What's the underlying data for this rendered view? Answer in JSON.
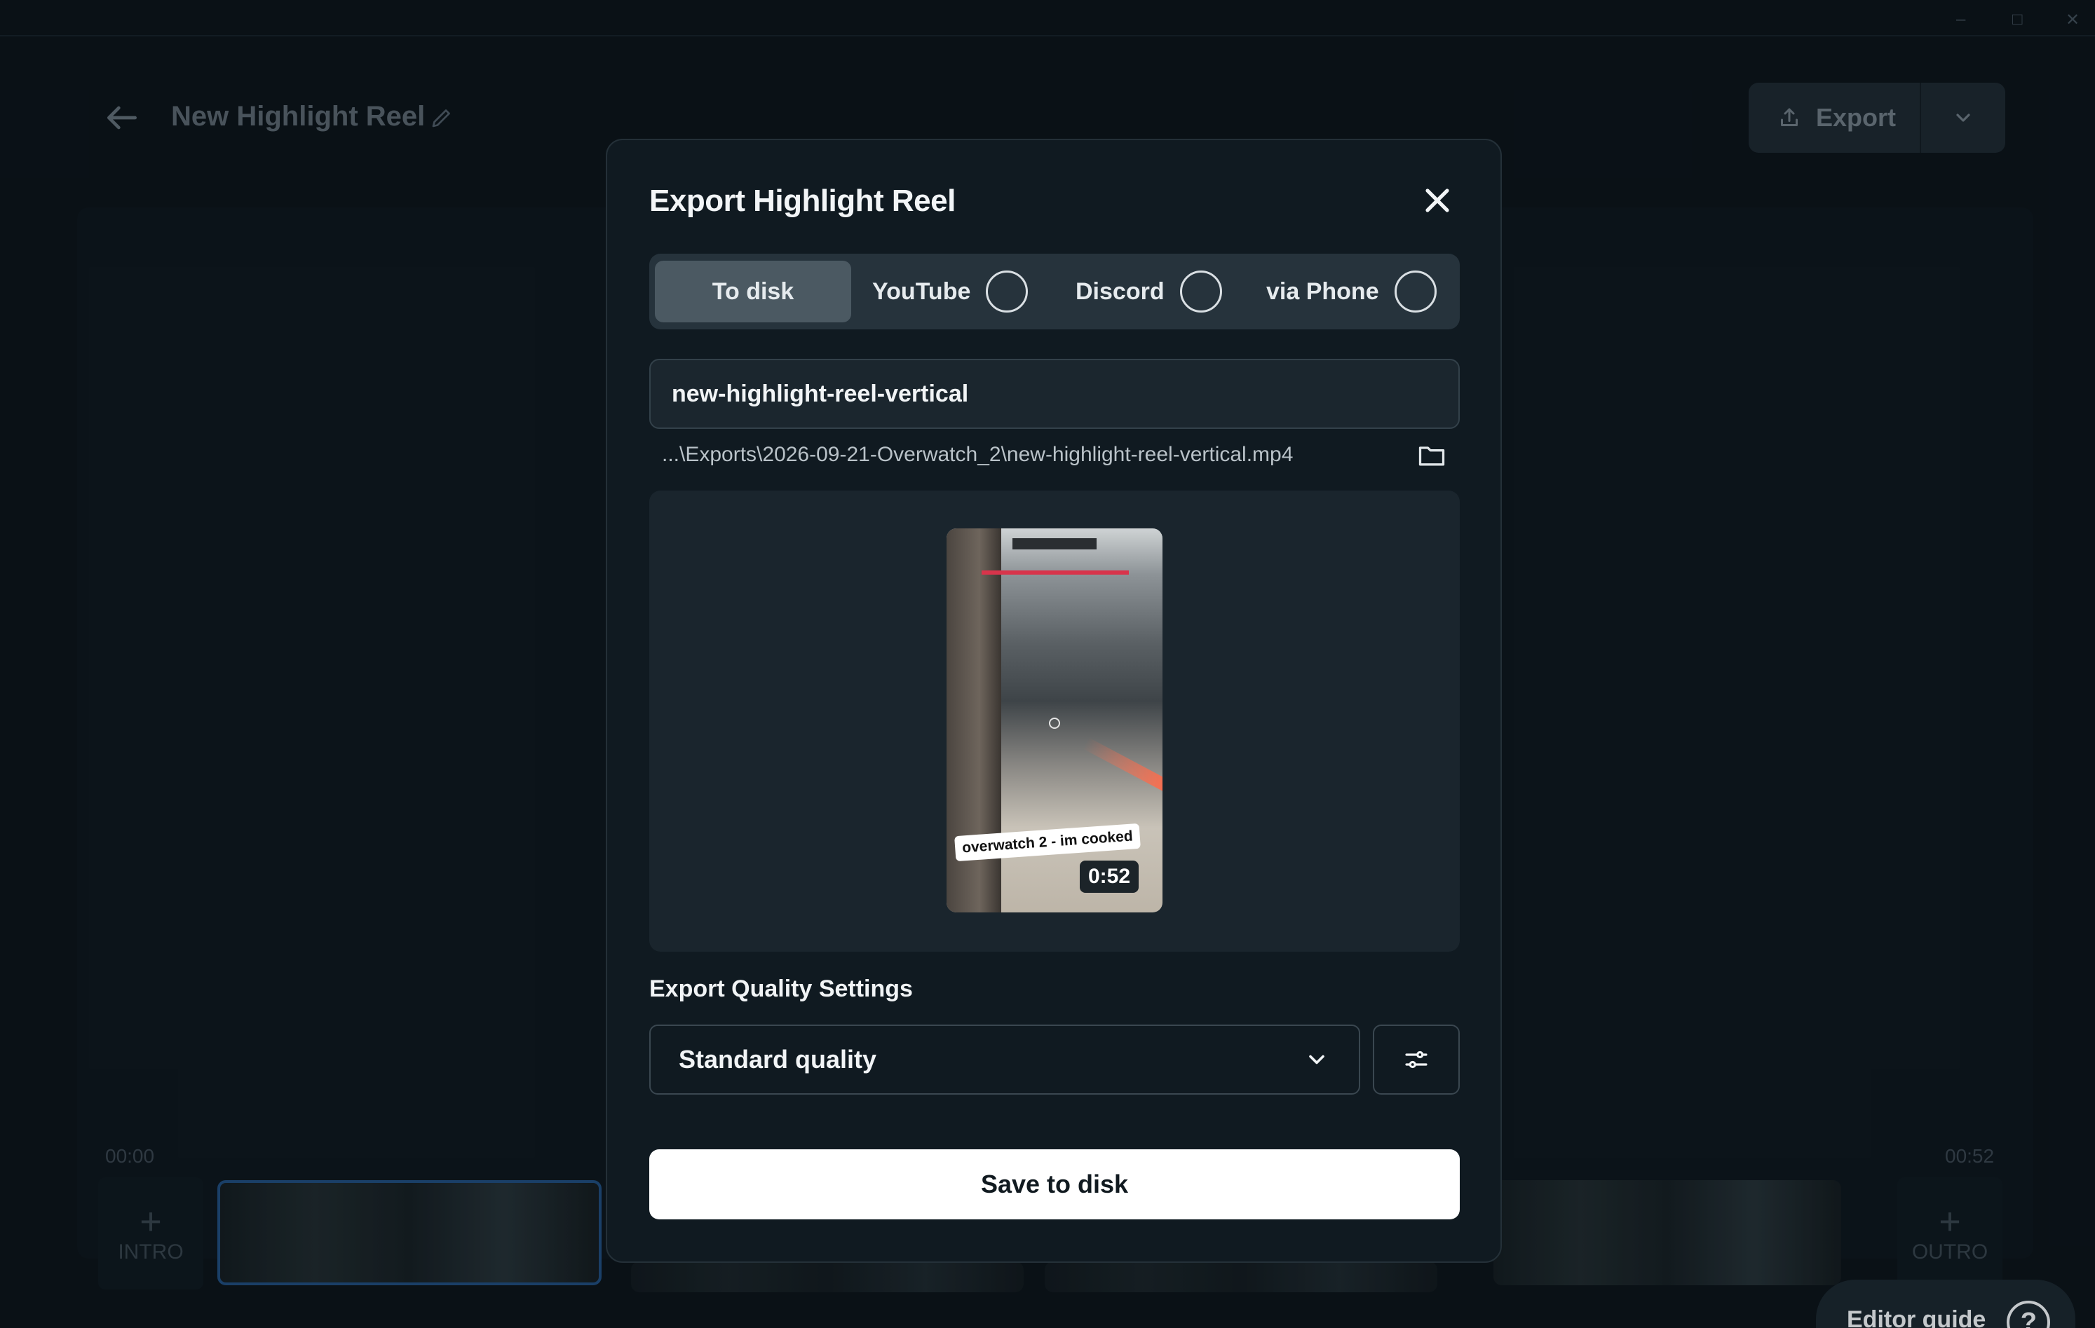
{
  "app": {
    "project_title": "New Highlight Reel",
    "export_label": "Export",
    "timeline": {
      "start_time": "00:00",
      "end_time": "00:52",
      "intro_label": "INTRO",
      "outro_label": "OUTRO"
    },
    "editor_guide_label": "Editor guide",
    "window_controls": [
      "–",
      "□",
      "✕"
    ]
  },
  "modal": {
    "title": "Export Highlight Reel",
    "tabs": [
      {
        "label": "To disk",
        "active": true
      },
      {
        "label": "YouTube",
        "active": false
      },
      {
        "label": "Discord",
        "active": false
      },
      {
        "label": "via Phone",
        "active": false
      }
    ],
    "filename_value": "new-highlight-reel-vertical",
    "file_path": "...\\Exports\\2026-09-21-Overwatch_2\\new-highlight-reel-vertical.mp4",
    "preview": {
      "caption": "overwatch 2 - im cooked",
      "duration": "0:52"
    },
    "quality_section_label": "Export Quality Settings",
    "quality_selected": "Standard quality",
    "save_button_label": "Save to disk"
  },
  "icons": {
    "back": "arrow-left-icon",
    "edit": "pencil-icon",
    "export": "upload-icon",
    "caret": "chevron-down-icon",
    "close": "close-icon",
    "folder": "folder-icon",
    "settings": "sliders-icon",
    "help": "question-icon"
  }
}
